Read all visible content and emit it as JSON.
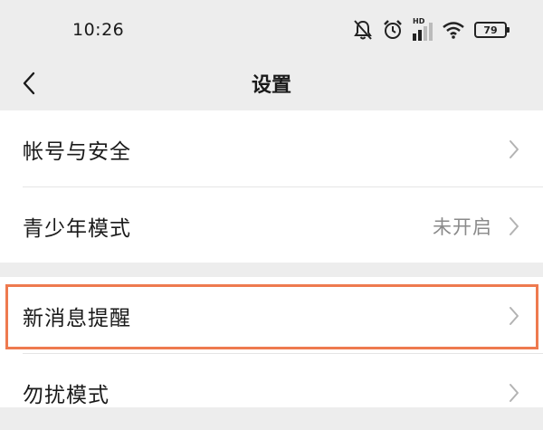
{
  "status_bar": {
    "time": "10:26",
    "icons": [
      "bell-muted-icon",
      "alarm-icon",
      "hd-signal-icon",
      "wifi-icon",
      "battery-icon"
    ],
    "signal_label": "HD",
    "battery": "79"
  },
  "nav": {
    "back_icon": "chevron-left-icon",
    "title": "设置"
  },
  "groups": [
    {
      "items": [
        {
          "label": "帐号与安全",
          "value": ""
        },
        {
          "label": "青少年模式",
          "value": "未开启"
        }
      ]
    },
    {
      "items": [
        {
          "label": "新消息提醒",
          "value": "",
          "highlighted": true
        },
        {
          "label": "勿扰模式",
          "value": ""
        }
      ]
    }
  ],
  "colors": {
    "background": "#ededed",
    "card": "#ffffff",
    "highlight_border": "#ee7a4f",
    "secondary_text": "#8a8a8a"
  }
}
